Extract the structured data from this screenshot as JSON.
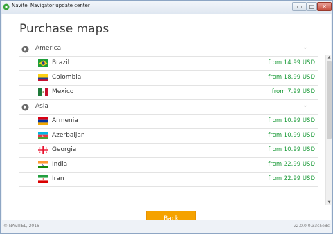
{
  "window": {
    "title": "Navitel Navigator update center",
    "controls": {
      "minimize": "▭",
      "maximize": "□",
      "close": "✕"
    }
  },
  "page": {
    "title": "Purchase maps"
  },
  "groups": [
    {
      "name": "America",
      "icon": "globe-icon",
      "chevron": "⌄",
      "items": [
        {
          "country": "Brazil",
          "price": "from 14.99 USD",
          "flag": "brazil-flag"
        },
        {
          "country": "Colombia",
          "price": "from 18.99 USD",
          "flag": "colombia-flag"
        },
        {
          "country": "Mexico",
          "price": "from 7.99 USD",
          "flag": "mexico-flag"
        }
      ]
    },
    {
      "name": "Asia",
      "icon": "globe-icon",
      "chevron": "⌄",
      "items": [
        {
          "country": "Armenia",
          "price": "from 10.99 USD",
          "flag": "armenia-flag"
        },
        {
          "country": "Azerbaijan",
          "price": "from 10.99 USD",
          "flag": "azerbaijan-flag"
        },
        {
          "country": "Georgia",
          "price": "from 10.99 USD",
          "flag": "georgia-flag"
        },
        {
          "country": "India",
          "price": "from 22.99 USD",
          "flag": "india-flag"
        },
        {
          "country": "Iran",
          "price": "from 22.99 USD",
          "flag": "iran-flag"
        }
      ]
    }
  ],
  "scrollbar": {
    "up": "▲",
    "down": "▼"
  },
  "buttons": {
    "back": "Back"
  },
  "footer": {
    "copyright": "© NAVITEL, 2016",
    "version": "v2.0.0.0.33c5e8c"
  },
  "colors": {
    "price": "#1f9c3c",
    "back_button": "#f5a200",
    "title_text": "#3c3c3c"
  }
}
